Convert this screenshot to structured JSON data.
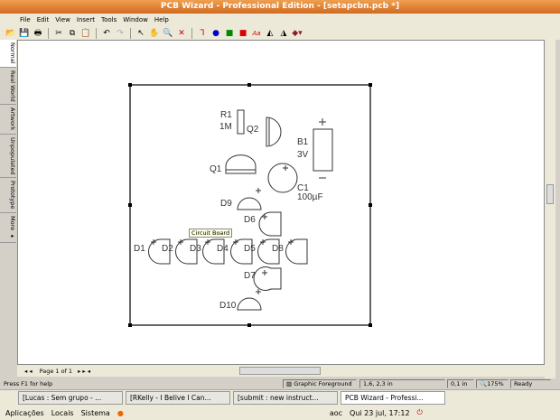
{
  "window": {
    "title": "PCB Wizard - Professional Edition - [setapcbn.pcb *]"
  },
  "menu": [
    "File",
    "Edit",
    "View",
    "Insert",
    "Tools",
    "Window",
    "Help"
  ],
  "side_tabs": [
    "Normal",
    "Real World",
    "Artwork",
    "Unpopulated",
    "Prototype",
    "More ▸"
  ],
  "board": {
    "labels": {
      "r1": "R1",
      "r1v": "1M",
      "q2": "Q2",
      "b1": "B1",
      "b1v": "3V",
      "q1": "Q1",
      "c1": "C1",
      "c1v": "100µF",
      "d9": "D9",
      "d6": "D6",
      "d1": "D1",
      "d2": "D2",
      "d3": "D3",
      "d4": "D4",
      "d5": "D5",
      "d8": "D8",
      "d7": "D7",
      "d10": "D10"
    },
    "tooltip": "Circuit Board"
  },
  "pager": {
    "label": "Page 1 of 1"
  },
  "status": {
    "help": "Press F1 for help",
    "layer": "Graphic Foreground",
    "coords": "1,6, 2,3 in",
    "grid": "0,1 in",
    "zoom": "175%",
    "state": "Ready"
  },
  "taskbar": [
    "[Lucas : Sem grupo - ...",
    "[RKelly - I Belive I Can...",
    "[submit : new instruct...",
    "PCB Wizard - Professi..."
  ],
  "panel": {
    "apps": "Aplicações",
    "places": "Locais",
    "system": "Sistema",
    "user": "aoc",
    "clock": "Qui 23 jul, 17:12"
  }
}
